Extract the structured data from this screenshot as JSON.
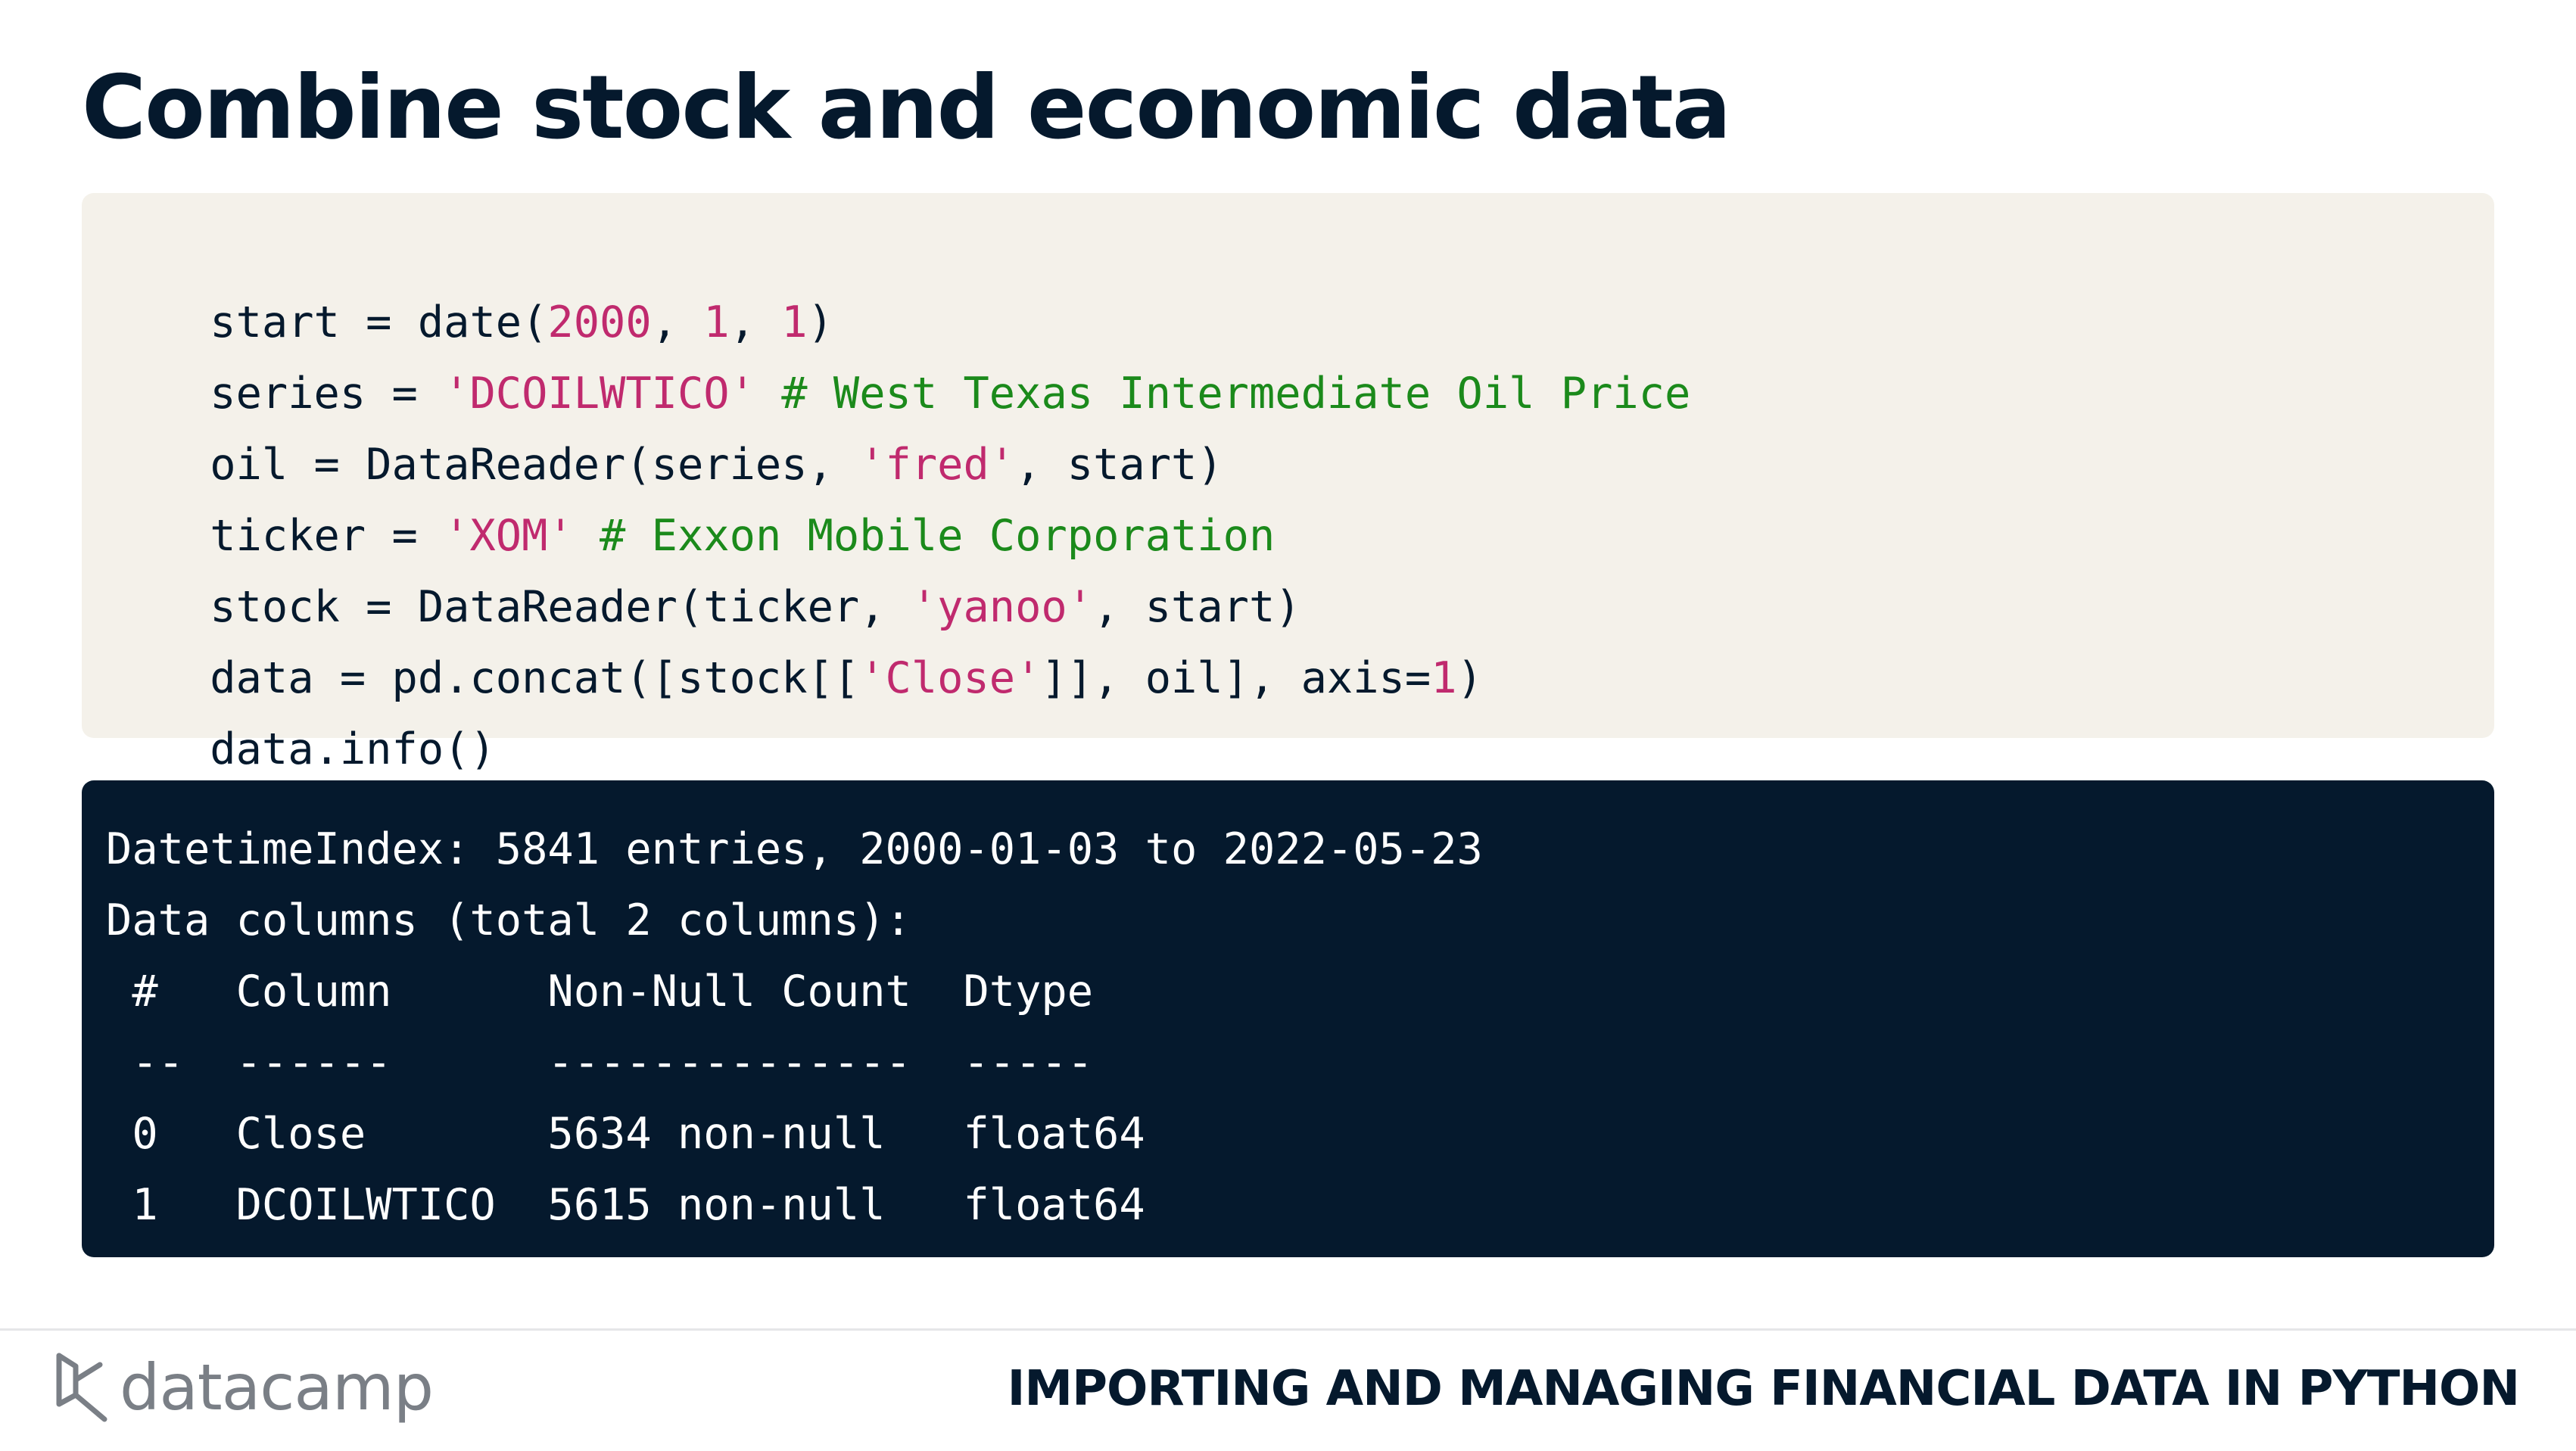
{
  "slide": {
    "title": "Combine stock and economic data"
  },
  "code": {
    "lines": [
      [
        {
          "t": "start = date(",
          "c": "plain"
        },
        {
          "t": "2000",
          "c": "num"
        },
        {
          "t": ", ",
          "c": "plain"
        },
        {
          "t": "1",
          "c": "num"
        },
        {
          "t": ", ",
          "c": "plain"
        },
        {
          "t": "1",
          "c": "num"
        },
        {
          "t": ")",
          "c": "plain"
        }
      ],
      [
        {
          "t": "series = ",
          "c": "plain"
        },
        {
          "t": "'DCOILWTICO'",
          "c": "str"
        },
        {
          "t": " # West Texas Intermediate Oil Price",
          "c": "com"
        }
      ],
      [
        {
          "t": "oil = DataReader(series, ",
          "c": "plain"
        },
        {
          "t": "'fred'",
          "c": "str"
        },
        {
          "t": ", start)",
          "c": "plain"
        }
      ],
      [
        {
          "t": "ticker = ",
          "c": "plain"
        },
        {
          "t": "'XOM'",
          "c": "str"
        },
        {
          "t": " # Exxon Mobile Corporation",
          "c": "com"
        }
      ],
      [
        {
          "t": "stock = DataReader(ticker, ",
          "c": "plain"
        },
        {
          "t": "'yanoo'",
          "c": "str"
        },
        {
          "t": ", start)",
          "c": "plain"
        }
      ],
      [
        {
          "t": "data = pd.concat([stock[[",
          "c": "plain"
        },
        {
          "t": "'Close'",
          "c": "str"
        },
        {
          "t": "]], oil], axis=",
          "c": "plain"
        },
        {
          "t": "1",
          "c": "num"
        },
        {
          "t": ")",
          "c": "plain"
        }
      ],
      [
        {
          "t": "data.info()",
          "c": "plain"
        }
      ]
    ]
  },
  "output": {
    "lines": [
      "DatetimeIndex: 5841 entries, 2000-01-03 to 2022-05-23",
      "Data columns (total 2 columns):",
      " #   Column      Non-Null Count  Dtype",
      " --  ------      --------------  -----",
      " 0   Close       5634 non-null   float64",
      " 1   DCOILWTICO  5615 non-null   float64"
    ]
  },
  "footer": {
    "logo_text": "datacamp",
    "logo_icon": "datacamp-logo-icon",
    "course_title": "IMPORTING AND MANAGING FINANCIAL DATA IN PYTHON"
  },
  "colors": {
    "navy": "#05192d",
    "code_bg": "#f4f1ea",
    "string": "#c02a6e",
    "comment": "#1b8a1b"
  }
}
